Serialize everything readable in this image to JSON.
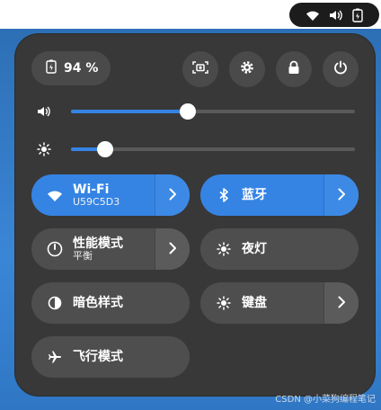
{
  "topbar": {
    "icons": [
      "wifi-icon",
      "volume-icon",
      "battery-icon"
    ]
  },
  "status": {
    "battery_percent": "94 %"
  },
  "quick_actions": [
    "screenshot-icon",
    "settings-icon",
    "lock-icon",
    "power-icon"
  ],
  "sliders": {
    "volume": {
      "icon": "volume-icon",
      "level": 0.41
    },
    "brightness": {
      "icon": "brightness-icon",
      "level": 0.12
    }
  },
  "tiles": {
    "wifi": {
      "title": "Wi-Fi",
      "subtitle": "U59C5D3",
      "active": true
    },
    "bluetooth": {
      "title": "蓝牙",
      "active": true
    },
    "power_mode": {
      "title": "性能模式",
      "subtitle": "平衡",
      "active": false
    },
    "night_light": {
      "title": "夜灯",
      "active": false
    },
    "dark_style": {
      "title": "暗色样式",
      "active": false
    },
    "keyboard": {
      "title": "键盘",
      "active": false
    },
    "airplane": {
      "title": "飞行模式",
      "active": false
    }
  },
  "watermark": "CSDN @小菜狗编程笔记",
  "colors": {
    "accent": "#3584e4",
    "panel": "#383838",
    "tile": "#4e4e4e"
  }
}
